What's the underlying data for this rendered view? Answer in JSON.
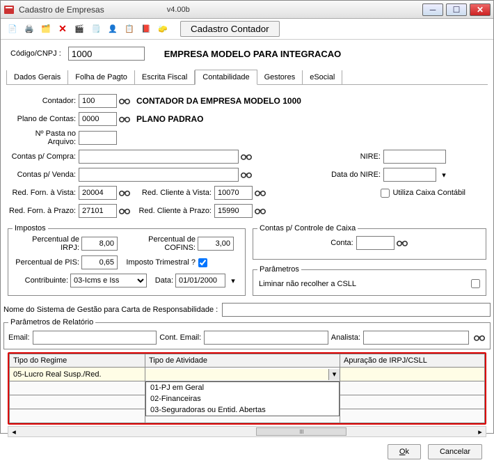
{
  "window": {
    "title": "Cadastro de Empresas",
    "version": "v4.00b"
  },
  "toolbar": {
    "cadastro_contador_label": "Cadastro Contador"
  },
  "header": {
    "codigo_cnpj_label": "Código/CNPJ :",
    "codigo_cnpj_value": "1000",
    "empresa_nome": "EMPRESA MODELO PARA INTEGRACAO"
  },
  "tabs": {
    "dados_gerais": "Dados Gerais",
    "folha": "Folha de Pagto",
    "escrita": "Escrita Fiscal",
    "contabilidade": "Contabilidade",
    "gestores": "Gestores",
    "esocial": "eSocial"
  },
  "contabilidade": {
    "contador_label": "Contador:",
    "contador_value": "100",
    "contador_nome": "CONTADOR DA EMPRESA MODELO 1000",
    "plano_label": "Plano de Contas:",
    "plano_value": "0000",
    "plano_nome": "PLANO PADRAO",
    "pasta_label": "Nº Pasta no Arquivo:",
    "pasta_value": "",
    "contas_compra_label": "Contas p/ Compra:",
    "contas_compra_value": "",
    "contas_venda_label": "Contas p/ Venda:",
    "contas_venda_value": "",
    "nire_label": "NIRE:",
    "nire_value": "",
    "data_nire_label": "Data do NIRE:",
    "data_nire_value": "",
    "utiliza_caixa_label": "Utiliza Caixa Contábil",
    "red_forn_vista_label": "Red. Forn. à Vista:",
    "red_forn_vista_value": "20004",
    "red_cli_vista_label": "Red. Cliente à Vista:",
    "red_cli_vista_value": "10070",
    "red_forn_prazo_label": "Red. Forn. à Prazo:",
    "red_forn_prazo_value": "27101",
    "red_cli_prazo_label": "Red. Cliente à Prazo:",
    "red_cli_prazo_value": "15990",
    "impostos": {
      "legend": "Impostos",
      "irpj_label": "Percentual de IRPJ:",
      "irpj_value": "8,00",
      "cofins_label": "Percentual de COFINS:",
      "cofins_value": "3,00",
      "pis_label": "Percentual de PIS:",
      "pis_value": "0,65",
      "trimestral_label": "Imposto Trimestral ?",
      "contribuinte_label": "Contribuinte:",
      "contribuinte_value": "03-Icms e Iss",
      "data_label": "Data:",
      "data_value": "01/01/2000"
    },
    "controle_caixa": {
      "legend": "Contas p/ Controle de Caixa",
      "conta_label": "Conta:",
      "conta_value": ""
    },
    "parametros": {
      "legend": "Parâmetros",
      "liminar_label": "Liminar não recolher a CSLL"
    },
    "gestao_label": "Nome do  Sistema de Gestão para Carta de Responsabilidade :",
    "gestao_value": "",
    "relatorio": {
      "legend": "Parâmetros de Relatório",
      "email_label": "Email:",
      "email_value": "",
      "cont_email_label": "Cont. Email:",
      "cont_email_value": "",
      "analista_label": "Analista:",
      "analista_value": ""
    },
    "grid": {
      "h1": "Tipo do Regime",
      "h2": "Tipo de Atividade",
      "h3": "Apuração de IRPJ/CSLL",
      "row1_regime": "05-Lucro Real Susp./Red.",
      "row1_atividade": "",
      "row1_apuracao": "",
      "options": {
        "o1": "01-PJ em Geral",
        "o2": "02-Financeiras",
        "o3": "03-Seguradoras ou Entid. Abertas"
      }
    }
  },
  "footer": {
    "ok": "Ok",
    "cancelar": "Cancelar"
  }
}
